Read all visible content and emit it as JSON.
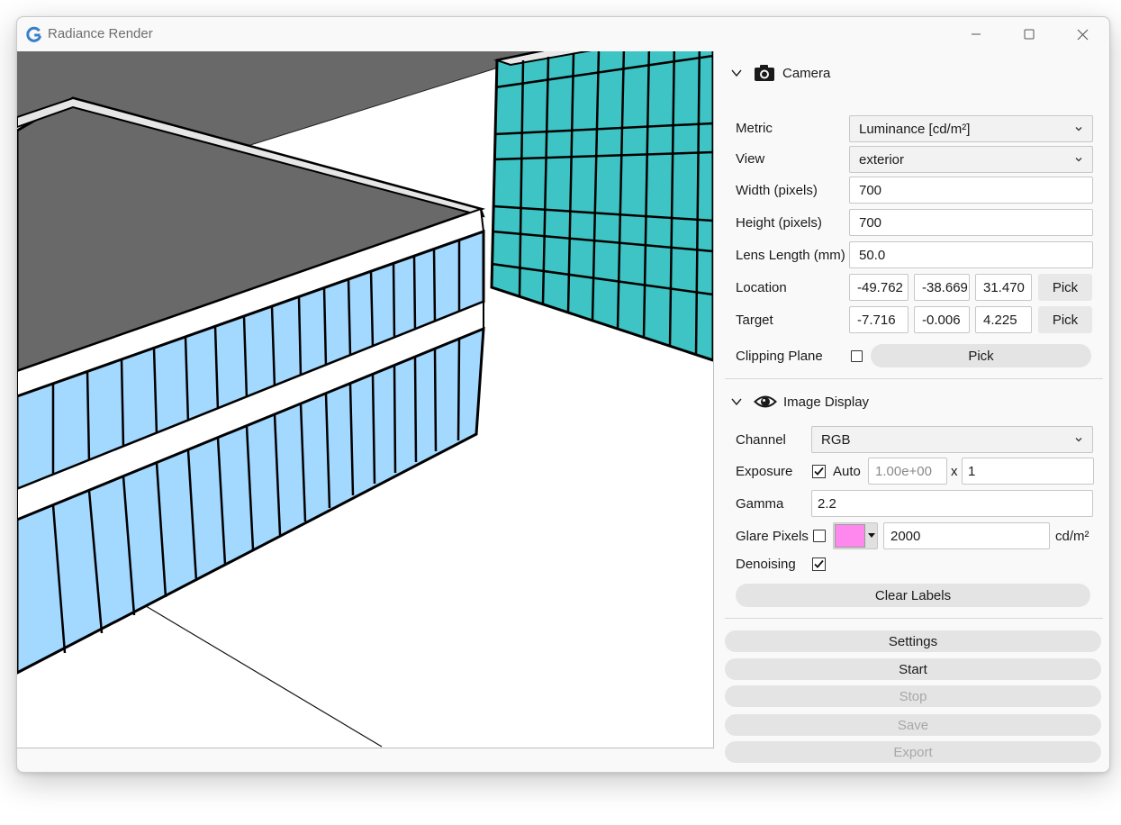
{
  "window": {
    "title": "Radiance Render"
  },
  "colors": {
    "glare_swatch": "#ff88ee",
    "glass_light": "#a3d8ff",
    "glass_teal": "#3ec4c4",
    "roof": "#696969"
  },
  "camera": {
    "section_title": "Camera",
    "metric_label": "Metric",
    "metric_value": "Luminance [cd/m²]",
    "view_label": "View",
    "view_value": "exterior",
    "width_label": "Width (pixels)",
    "width_value": "700",
    "height_label": "Height (pixels)",
    "height_value": "700",
    "lens_label": "Lens Length (mm)",
    "lens_value": "50.0",
    "location_label": "Location",
    "location_x": "-49.762",
    "location_y": "-38.669",
    "location_z": "31.470",
    "location_pick": "Pick",
    "target_label": "Target",
    "target_x": "-7.716",
    "target_y": "-0.006",
    "target_z": "4.225",
    "target_pick": "Pick",
    "clipping_label": "Clipping Plane",
    "clipping_checked": false,
    "clipping_pick": "Pick"
  },
  "image_display": {
    "section_title": "Image Display",
    "channel_label": "Channel",
    "channel_value": "RGB",
    "exposure_label": "Exposure",
    "exposure_auto_checked": true,
    "exposure_auto_label": "Auto",
    "exposure_value": "1.00e+00",
    "exposure_times": "x",
    "exposure_multiplier": "1",
    "gamma_label": "Gamma",
    "gamma_value": "2.2",
    "glare_label": "Glare Pixels",
    "glare_checked": false,
    "glare_threshold": "2000",
    "glare_unit": "cd/m²",
    "denoising_label": "Denoising",
    "denoising_checked": true,
    "clear_labels": "Clear Labels"
  },
  "actions": {
    "settings": "Settings",
    "start": "Start",
    "stop": "Stop",
    "save": "Save",
    "export": "Export"
  }
}
